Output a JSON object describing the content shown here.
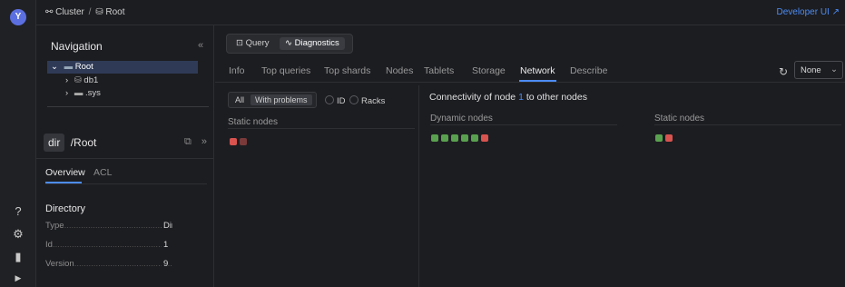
{
  "breadcrumb": {
    "cluster": "Cluster",
    "separator": "/",
    "root": "Root"
  },
  "header": {
    "developer_ui": "Developer UI"
  },
  "navigation": {
    "title": "Navigation",
    "collapse": "«",
    "tree": [
      {
        "label": "Root",
        "chevron": "⌄",
        "icon": "folder-icon"
      },
      {
        "label": "db1",
        "chevron": "›",
        "icon": "database-icon"
      },
      {
        "label": ".sys",
        "chevron": "›",
        "icon": "folder-icon"
      }
    ]
  },
  "object": {
    "type_badge": "dir",
    "path": "/Root",
    "tabs": [
      "Overview",
      "ACL"
    ],
    "section_title": "Directory",
    "fields": [
      {
        "label": "Type",
        "value": "Dir"
      },
      {
        "label": "Id",
        "value": "1"
      },
      {
        "label": "Version",
        "value": "9"
      }
    ]
  },
  "modes": {
    "query": "Query",
    "diagnostics": "Diagnostics"
  },
  "tabs": [
    "Info",
    "Top queries",
    "Top shards",
    "Nodes",
    "Tablets",
    "Storage",
    "Network",
    "Describe"
  ],
  "active_tab": "Network",
  "toolbar": {
    "select_value": "None"
  },
  "filters": {
    "all": "All",
    "with_problems": "With problems",
    "id": "ID",
    "racks": "Racks"
  },
  "left_panel": {
    "static_nodes_label": "Static nodes"
  },
  "connectivity": {
    "prefix": "Connectivity of node",
    "node_id": "1",
    "suffix": "to other nodes",
    "dynamic_label": "Dynamic nodes",
    "static_label": "Static nodes"
  },
  "colors": {
    "green": "#5aa14f",
    "red": "#d9534f",
    "red_dim": "#7a3a3a",
    "accent": "#4c8cf5"
  },
  "node_status": {
    "left_static": [
      "red",
      "red_dim"
    ],
    "dynamic": [
      "green",
      "green",
      "green",
      "green",
      "green",
      "red"
    ],
    "right_static": [
      "green",
      "red"
    ]
  }
}
